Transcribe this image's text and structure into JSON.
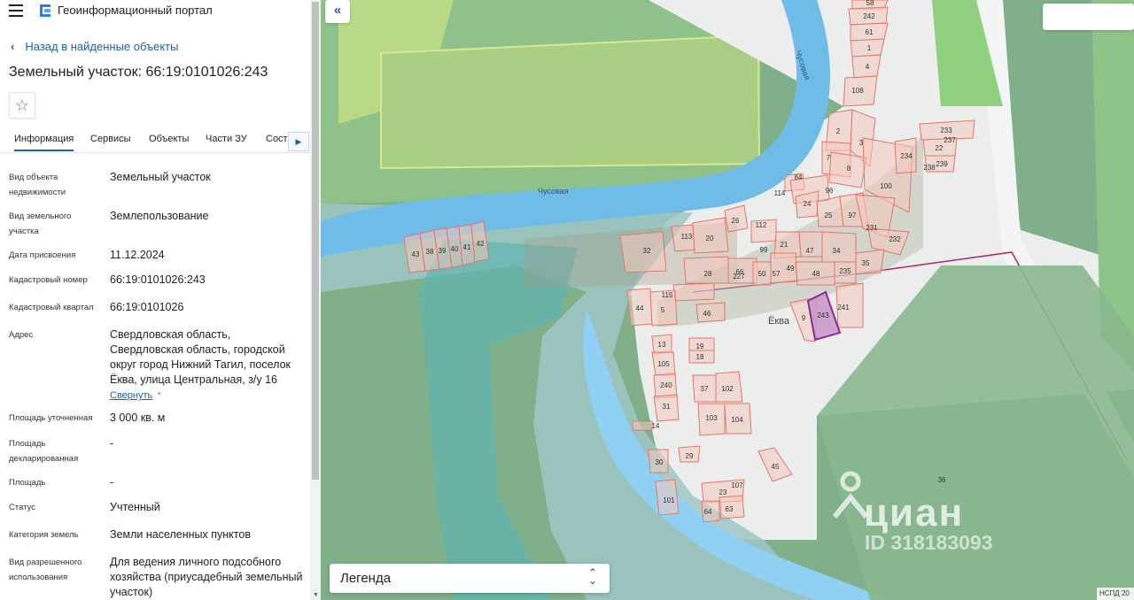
{
  "portal": {
    "title": "Геоинформационный портал",
    "menu_icon": "hamburger-icon",
    "logo_icon": "portal-logo-icon"
  },
  "nav": {
    "back_label": "Назад в найденные объекты"
  },
  "object": {
    "title": "Земельный участок: 66:19:0101026:243"
  },
  "tabs": [
    {
      "label": "Информация",
      "active": true
    },
    {
      "label": "Сервисы"
    },
    {
      "label": "Объекты"
    },
    {
      "label": "Части ЗУ"
    },
    {
      "label": "Состав"
    }
  ],
  "fields": [
    {
      "label": "Вид объекта недвижимости",
      "value": "Земельный участок"
    },
    {
      "label": "Вид земельного участка",
      "value": "Землепользование"
    },
    {
      "label": "Дата присвоения",
      "value": "11.12.2024"
    },
    {
      "label": "Кадастровый номер",
      "value": "66:19:0101026:243"
    },
    {
      "label": "Кадастровый квартал",
      "value": "66:19:0101026"
    },
    {
      "label": "Адрес",
      "value": "Свердловская область, Свердловская область, городской округ город Нижний Тагил, поселок Ёква, улица Центральная, з/у 16"
    },
    {
      "label": "Площадь уточненная",
      "value": "3 000 кв. м"
    },
    {
      "label": "Площадь декларированная",
      "value": "-"
    },
    {
      "label": "Площадь",
      "value": "-"
    },
    {
      "label": "Статус",
      "value": "Учтенный"
    },
    {
      "label": "Категория земель",
      "value": "Земли населенных пунктов"
    },
    {
      "label": "Вид разрешенного использования",
      "value": "Для ведения личного подсобного хозяйства (приусадебный земельный участок)"
    }
  ],
  "address_collapse": "Свернуть",
  "map": {
    "river_labels": [
      "Чусовая",
      "Чусовая"
    ],
    "village_label": "Ёква",
    "legend_label": "Легенда",
    "attribution": "НСПД 20",
    "watermark_text": "циан",
    "watermark_id": "ID 318183093",
    "parcels": [
      "58",
      "242",
      "61",
      "1",
      "4",
      "108",
      "2",
      "3",
      "7",
      "8",
      "100",
      "233",
      "237",
      "22",
      "234",
      "238",
      "239",
      "84",
      "96",
      "114",
      "24",
      "25",
      "97",
      "26",
      "112",
      "231",
      "232",
      "113",
      "20",
      "99",
      "21",
      "47",
      "34",
      "32",
      "28",
      "227",
      "50",
      "57",
      "49",
      "48",
      "235",
      "35",
      "115",
      "44",
      "5",
      "46",
      "9",
      "243",
      "241",
      "13",
      "19",
      "18",
      "105",
      "240",
      "37",
      "102",
      "31",
      "103",
      "104",
      "14",
      "29",
      "30",
      "45",
      "107",
      "23",
      "101",
      "64",
      "63",
      "36",
      "43",
      "38",
      "39",
      "40",
      "41",
      "42",
      "66"
    ]
  },
  "colors": {
    "accent": "#1f5fa8",
    "parcel_fill": "#f6c8bd",
    "parcel_stroke": "#e3776a",
    "selected_stroke": "#8e2b8e",
    "water": "#8fcbef",
    "forest": "#7fb38a"
  }
}
